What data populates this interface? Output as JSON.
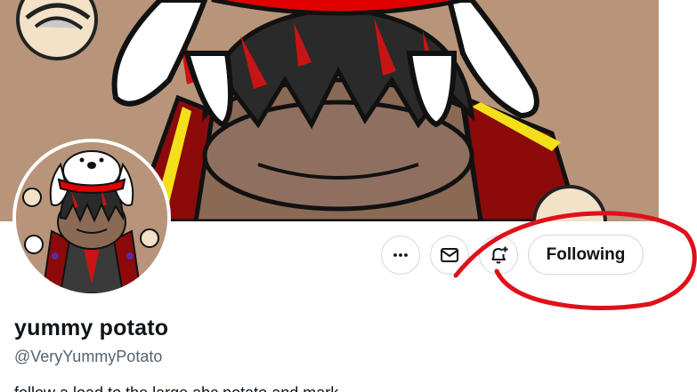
{
  "profile": {
    "display_name": "yummy potato",
    "handle": "@VeryYummyPotato",
    "bio_partial": "follow a load to the large abc potato and mark"
  },
  "actions": {
    "more_icon": "more-horizontal-icon",
    "message_icon": "envelope-icon",
    "notify_icon": "bell-plus-icon",
    "follow_label": "Following"
  },
  "colors": {
    "banner_bg": "#b8957a",
    "annotation_red": "#e0101a",
    "button_border": "#cfd9de",
    "text_primary": "#0f1419",
    "text_secondary": "#536471"
  }
}
